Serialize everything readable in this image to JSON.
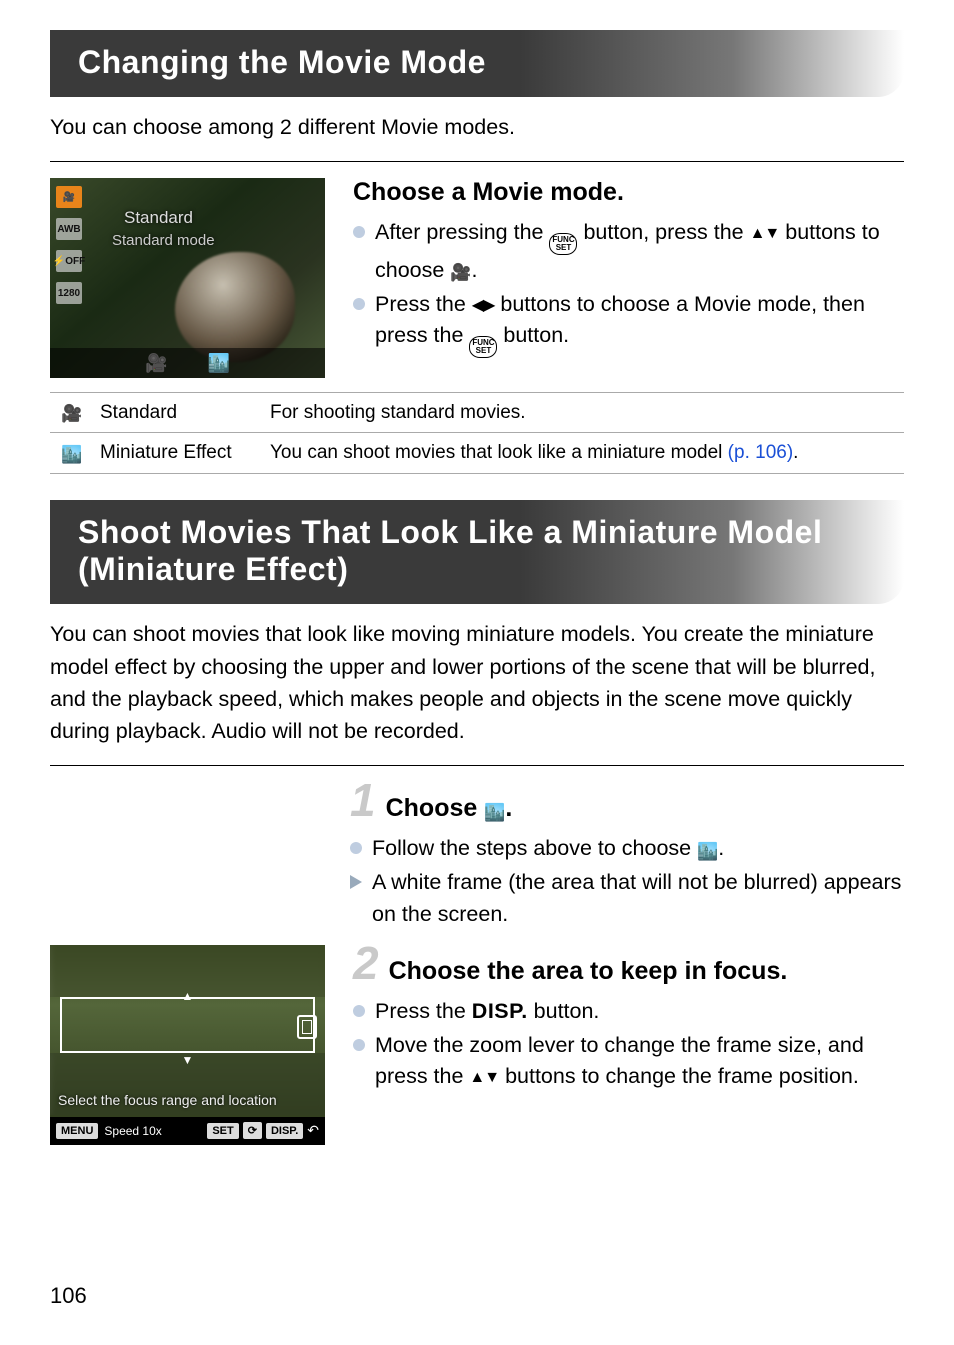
{
  "page_number": "106",
  "section1": {
    "title": "Changing the Movie Mode",
    "intro": "You can choose among 2 different Movie modes.",
    "shot": {
      "label": "Standard",
      "sublabel": "Standard mode",
      "left_icons": [
        "🎥",
        "AWB",
        "⚡OFF",
        "1280"
      ]
    },
    "step_title": "Choose a Movie mode.",
    "bullet1_a": "After pressing the ",
    "bullet1_b": " button, press the ",
    "bullet1_c": " buttons to choose ",
    "bullet1_d": ".",
    "bullet2_a": "Press the ",
    "bullet2_b": " buttons to choose a Movie mode, then press the ",
    "bullet2_c": " button.",
    "func_label": "FUNC SET",
    "movie_glyph": "🎥",
    "mini_glyph": "🎥",
    "table": [
      {
        "name": "Standard",
        "desc": "For shooting standard movies."
      },
      {
        "name": "Miniature Effect",
        "desc_a": "You can shoot movies that look like a miniature model ",
        "desc_link": "(p. 106)",
        "desc_b": "."
      }
    ]
  },
  "section2": {
    "title": "Shoot Movies That Look Like a Miniature Model (Miniature Effect)",
    "intro": "You can shoot movies that look like moving miniature models. You create the miniature model effect by choosing the upper and lower portions of the scene that will be blurred, and the playback speed, which makes people and objects in the scene move quickly during playback. Audio will not be recorded.",
    "step1": {
      "num": "1",
      "title_a": "Choose ",
      "title_b": ".",
      "b1": "Follow the steps above to choose ",
      "b1b": ".",
      "b2": "A white frame (the area that will not be blurred) appears on the screen."
    },
    "step2": {
      "num": "2",
      "title": "Choose the area to keep in focus.",
      "b1a": "Press the ",
      "disp": "DISP.",
      "b1b": " button.",
      "b2a": "Move the zoom lever to change the frame size, and press the ",
      "b2b": " buttons to change the frame position."
    },
    "shot": {
      "caption": "Select the focus range and location",
      "menu": "MENU",
      "speed": "Speed 10x",
      "set": "SET",
      "disp": "DISP."
    }
  }
}
